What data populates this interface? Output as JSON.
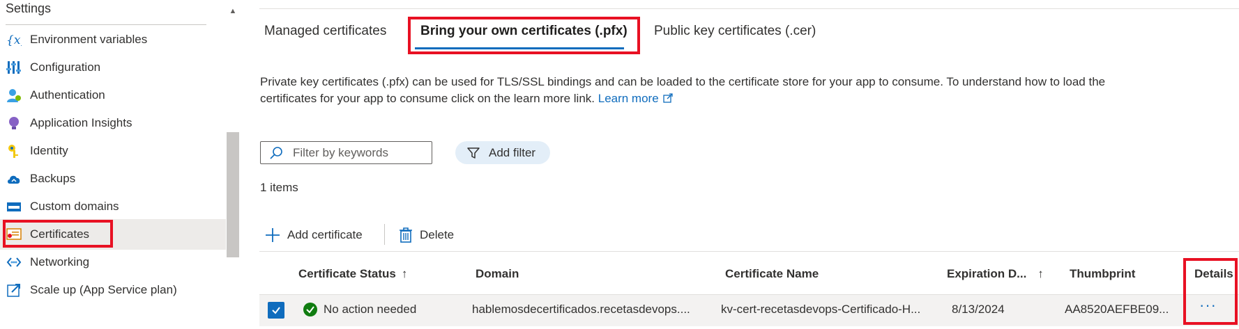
{
  "sidebar": {
    "section_title": "Settings",
    "items": [
      {
        "label": "Environment variables",
        "icon": "variables-icon"
      },
      {
        "label": "Configuration",
        "icon": "configuration-icon"
      },
      {
        "label": "Authentication",
        "icon": "authentication-icon"
      },
      {
        "label": "Application Insights",
        "icon": "application-insights-icon"
      },
      {
        "label": "Identity",
        "icon": "identity-key-icon"
      },
      {
        "label": "Backups",
        "icon": "backups-cloud-icon"
      },
      {
        "label": "Custom domains",
        "icon": "custom-domains-icon"
      },
      {
        "label": "Certificates",
        "icon": "certificate-icon",
        "selected": true
      },
      {
        "label": "Networking",
        "icon": "networking-icon"
      },
      {
        "label": "Scale up (App Service plan)",
        "icon": "scale-up-icon"
      }
    ]
  },
  "tabs": [
    {
      "label": "Managed certificates"
    },
    {
      "label": "Bring your own certificates (.pfx)",
      "active": true
    },
    {
      "label": "Public key certificates (.cer)"
    }
  ],
  "description": {
    "text": "Private key certificates (.pfx) can be used for TLS/SSL bindings and can be loaded to the certificate store for your app to consume. To understand how to load the certificates for your app to consume click on the learn more link.",
    "link_label": "Learn more"
  },
  "search": {
    "placeholder": "Filter by keywords",
    "value": ""
  },
  "add_filter_label": "Add filter",
  "items_count": "1 items",
  "commands": {
    "add_label": "Add certificate",
    "delete_label": "Delete"
  },
  "table": {
    "columns": [
      "Certificate Status",
      "Domain",
      "Certificate Name",
      "Expiration D...",
      "Thumbprint",
      "Details"
    ],
    "sort_arrow": "↑",
    "rows": [
      {
        "selected": true,
        "status": "No action needed",
        "domain": "hablemosdecertificados.recetasdevops....",
        "name": "kv-cert-recetasdevops-Certificado-H...",
        "expiration": "8/13/2024",
        "thumbprint": "AA8520AEFBE09...",
        "details": "···"
      }
    ]
  },
  "colors": {
    "accent": "#0f6cbd",
    "highlight": "#e81123",
    "success": "#107c10"
  }
}
